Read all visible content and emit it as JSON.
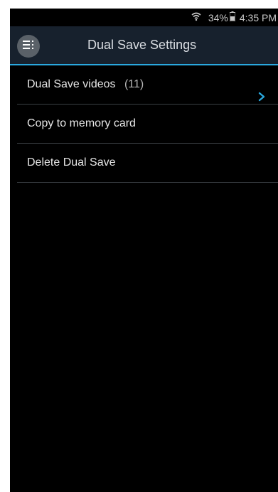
{
  "status": {
    "battery_percent": "34%",
    "time": "4:35 PM",
    "wifi_icon": "wifi-icon",
    "battery_icon": "battery-icon"
  },
  "header": {
    "title": "Dual Save Settings",
    "menu_icon": "menu-icon"
  },
  "items": [
    {
      "label": "Dual Save videos",
      "count": "(11)",
      "has_chevron": true
    },
    {
      "label": "Copy to memory card"
    },
    {
      "label": "Delete Dual Save"
    }
  ],
  "colors": {
    "accent": "#2aa8de",
    "background": "#000000",
    "app_bar": "#17212d"
  }
}
